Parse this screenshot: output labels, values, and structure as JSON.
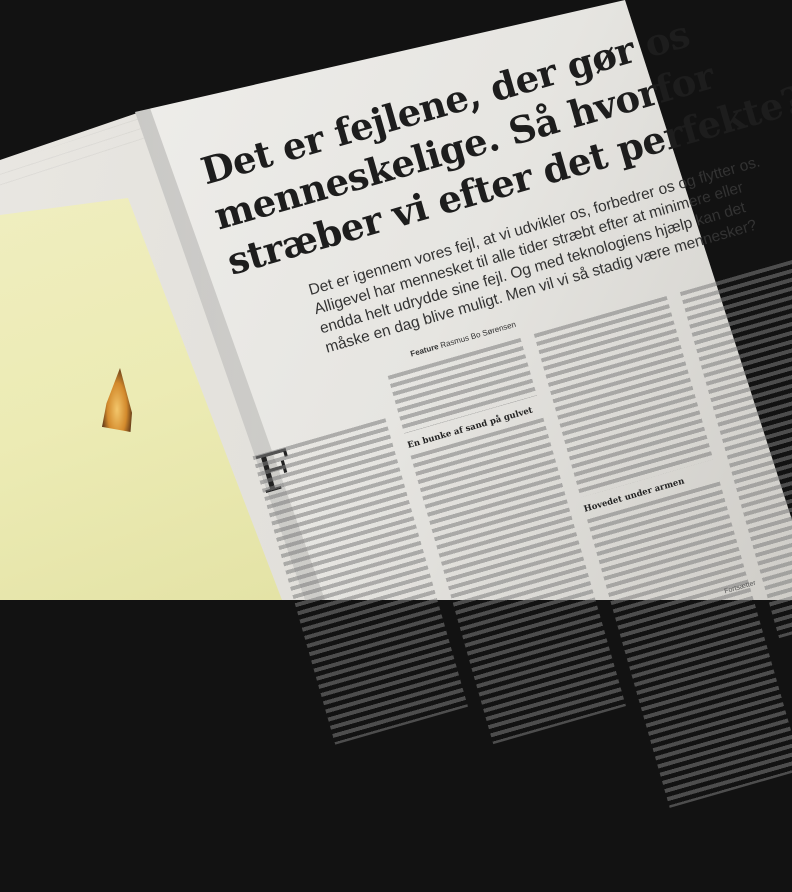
{
  "article": {
    "headline": "Det er fejlene, der gør os menneskelige. Så hvorfor stræber vi efter det perfekte?",
    "lede": "Det er igennem vores fejl, at vi udvikler os, forbedrer os og flytter os. Alligevel har mennesket til alle tider stræbt efter at minimere eller endda helt udrydde sine fejl. Og med teknologiens hjælp kan det måske en dag blive muligt. Men vil vi så stadig være mennesker?",
    "byline_label": "Feature",
    "byline_author": "Rasmus Bo Sørensen",
    "dropcap": "F",
    "subheads": [
      "En bunke af sand på gulvet",
      "Hovedet under armen"
    ],
    "footer": "Fortsætter"
  },
  "colors": {
    "background": "#121212",
    "paper": "#ecebe7",
    "image_yellow": "#ecebb4"
  }
}
